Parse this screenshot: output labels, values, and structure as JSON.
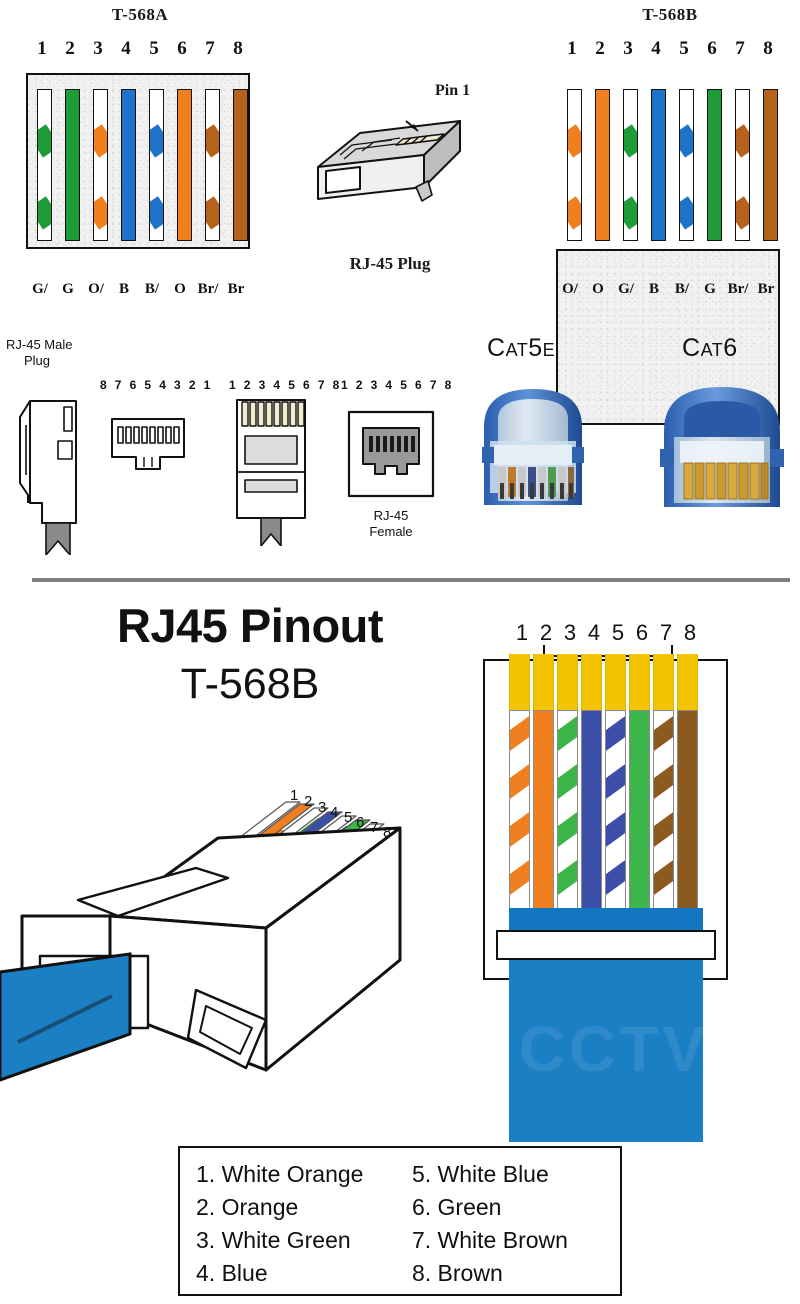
{
  "top_section": {
    "standard_a": {
      "title": "T-568A",
      "pin_numbers": [
        "1",
        "2",
        "3",
        "4",
        "5",
        "6",
        "7",
        "8"
      ],
      "wire_labels": [
        "G/",
        "G",
        "O/",
        "B",
        "B/",
        "O",
        "Br/",
        "Br"
      ],
      "wires": [
        {
          "pin": "1",
          "label": "G/",
          "color": "#1F9C37",
          "type": "striped",
          "name": "White Green"
        },
        {
          "pin": "2",
          "label": "G",
          "color": "#1F9C37",
          "type": "solid",
          "name": "Green"
        },
        {
          "pin": "3",
          "label": "O/",
          "color": "#F07F20",
          "type": "striped",
          "name": "White Orange"
        },
        {
          "pin": "4",
          "label": "B",
          "color": "#1E72C8",
          "type": "solid",
          "name": "Blue"
        },
        {
          "pin": "5",
          "label": "B/",
          "color": "#1E72C8",
          "type": "striped",
          "name": "White Blue"
        },
        {
          "pin": "6",
          "label": "O",
          "color": "#F07F20",
          "type": "solid",
          "name": "Orange"
        },
        {
          "pin": "7",
          "label": "Br/",
          "color": "#B4621C",
          "type": "striped",
          "name": "White Brown"
        },
        {
          "pin": "8",
          "label": "Br",
          "color": "#B4621C",
          "type": "solid",
          "name": "Brown"
        }
      ]
    },
    "standard_b": {
      "title": "T-568B",
      "pin_numbers": [
        "1",
        "2",
        "3",
        "4",
        "5",
        "6",
        "7",
        "8"
      ],
      "wire_labels": [
        "O/",
        "O",
        "G/",
        "B",
        "B/",
        "G",
        "Br/",
        "Br"
      ],
      "wires": [
        {
          "pin": "1",
          "label": "O/",
          "color": "#F07F20",
          "type": "striped",
          "name": "White Orange"
        },
        {
          "pin": "2",
          "label": "O",
          "color": "#F07F20",
          "type": "solid",
          "name": "Orange"
        },
        {
          "pin": "3",
          "label": "G/",
          "color": "#1F9C37",
          "type": "striped",
          "name": "White Green"
        },
        {
          "pin": "4",
          "label": "B",
          "color": "#1E72C8",
          "type": "solid",
          "name": "Blue"
        },
        {
          "pin": "5",
          "label": "B/",
          "color": "#1E72C8",
          "type": "striped",
          "name": "White Blue"
        },
        {
          "pin": "6",
          "label": "G",
          "color": "#1F9C37",
          "type": "solid",
          "name": "Green"
        },
        {
          "pin": "7",
          "label": "Br/",
          "color": "#B4621C",
          "type": "striped",
          "name": "White Brown"
        },
        {
          "pin": "8",
          "label": "Br",
          "color": "#B4621C",
          "type": "solid",
          "name": "Brown"
        }
      ]
    },
    "plug_diagram": {
      "pin1_label": "Pin 1",
      "caption": "RJ-45 Plug"
    }
  },
  "mid_section": {
    "male_plug_label_line1": "RJ-45 Male",
    "male_plug_label_line2": "Plug",
    "numbering_reversed": "8 7 6 5 4 3 2 1",
    "numbering_forward_1": "1 2 3 4 5 6 7 8",
    "numbering_forward_2": "1 2 3 4 5 6 7 8",
    "female_label_line1": "RJ-45",
    "female_label_line2": "Female",
    "cat5e_label_main": "C",
    "cat5e_label_small1": "AT",
    "cat5e_label_mid": "5",
    "cat5e_label_small2": "E",
    "cat6_label_main": "C",
    "cat6_label_small1": "AT",
    "cat6_label_mid": "6"
  },
  "main_section": {
    "title": "RJ45 Pinout",
    "subtitle": "T-568B",
    "iso_plug_numbers": [
      "1",
      "2",
      "3",
      "4",
      "5",
      "6",
      "7",
      "8"
    ],
    "panel_numbers": [
      "1",
      "2",
      "3",
      "4",
      "5",
      "6",
      "7",
      "8"
    ],
    "watermark_text": "CCTV",
    "panel_wires": [
      {
        "pin": "1",
        "color": "#F07F20",
        "type": "striped",
        "name": "White Orange"
      },
      {
        "pin": "2",
        "color": "#F07F20",
        "type": "solid",
        "name": "Orange"
      },
      {
        "pin": "3",
        "color": "#3CB54A",
        "type": "striped",
        "name": "White Green"
      },
      {
        "pin": "4",
        "color": "#3B4FA8",
        "type": "solid",
        "name": "Blue"
      },
      {
        "pin": "5",
        "color": "#3B4FA8",
        "type": "striped",
        "name": "White Blue"
      },
      {
        "pin": "6",
        "color": "#3CB54A",
        "type": "solid",
        "name": "Green"
      },
      {
        "pin": "7",
        "color": "#8B5A1E",
        "type": "striped",
        "name": "White Brown"
      },
      {
        "pin": "8",
        "color": "#8B5A1E",
        "type": "solid",
        "name": "Brown"
      }
    ],
    "contact_color": "#F5C400",
    "jacket_color": "#1B7FC4"
  },
  "legend": {
    "column_left": [
      "1. White Orange",
      "2. Orange",
      "3. White Green",
      "4. Blue"
    ],
    "column_right": [
      "5. White Blue",
      "6. Green",
      "7. White Brown",
      "8. Brown"
    ]
  },
  "colors": {
    "orange": "#F07F20",
    "green": "#3CB54A",
    "blue": "#3B4FA8",
    "brown": "#8B5A1E",
    "gold": "#F5C400",
    "jacket_blue": "#1B7FC4",
    "divider_gray": "#808080"
  }
}
